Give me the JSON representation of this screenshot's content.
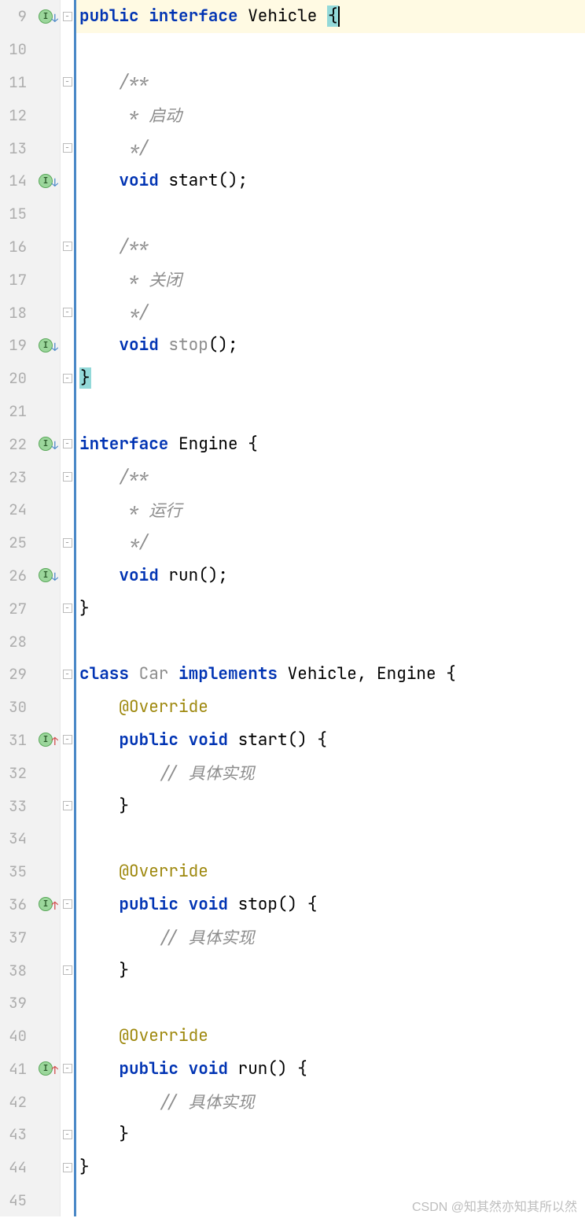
{
  "watermark": "CSDN @知其然亦知其所以然",
  "lines": [
    {
      "n": "9",
      "badge": "I",
      "arrow": "down",
      "foldOpen": true,
      "hl": true,
      "tokens": [
        [
          "kw",
          "public "
        ],
        [
          "kw",
          "interface "
        ],
        [
          "type",
          "Vehicle "
        ],
        [
          "hl-brace",
          "{"
        ],
        [
          "cursor",
          ""
        ]
      ]
    },
    {
      "n": "10",
      "tokens": []
    },
    {
      "n": "11",
      "foldOpen": true,
      "tokens": [
        [
          "plain",
          "    "
        ],
        [
          "comment",
          "/**"
        ]
      ]
    },
    {
      "n": "12",
      "tokens": [
        [
          "plain",
          "     "
        ],
        [
          "comment",
          "* 启动"
        ]
      ]
    },
    {
      "n": "13",
      "foldClose": true,
      "tokens": [
        [
          "plain",
          "     "
        ],
        [
          "comment",
          "*/"
        ]
      ]
    },
    {
      "n": "14",
      "badge": "I",
      "arrow": "down",
      "tokens": [
        [
          "plain",
          "    "
        ],
        [
          "kw",
          "void "
        ],
        [
          "ident",
          "start"
        ],
        [
          "paren",
          "();"
        ]
      ]
    },
    {
      "n": "15",
      "tokens": []
    },
    {
      "n": "16",
      "foldOpen": true,
      "tokens": [
        [
          "plain",
          "    "
        ],
        [
          "comment",
          "/**"
        ]
      ]
    },
    {
      "n": "17",
      "tokens": [
        [
          "plain",
          "     "
        ],
        [
          "comment",
          "* 关闭"
        ]
      ]
    },
    {
      "n": "18",
      "foldClose": true,
      "tokens": [
        [
          "plain",
          "     "
        ],
        [
          "comment",
          "*/"
        ]
      ]
    },
    {
      "n": "19",
      "badge": "I",
      "arrow": "down",
      "tokens": [
        [
          "plain",
          "    "
        ],
        [
          "kw",
          "void "
        ],
        [
          "dim",
          "stop"
        ],
        [
          "paren",
          "();"
        ]
      ]
    },
    {
      "n": "20",
      "foldClose": true,
      "tokens": [
        [
          "hl-brace",
          "}"
        ]
      ]
    },
    {
      "n": "21",
      "tokens": []
    },
    {
      "n": "22",
      "badge": "I",
      "arrow": "down",
      "foldOpen": true,
      "tokens": [
        [
          "kw",
          "interface "
        ],
        [
          "type",
          "Engine "
        ],
        [
          "paren",
          "{"
        ]
      ]
    },
    {
      "n": "23",
      "foldOpen": true,
      "tokens": [
        [
          "plain",
          "    "
        ],
        [
          "comment",
          "/**"
        ]
      ]
    },
    {
      "n": "24",
      "tokens": [
        [
          "plain",
          "     "
        ],
        [
          "comment",
          "* 运行"
        ]
      ]
    },
    {
      "n": "25",
      "foldClose": true,
      "tokens": [
        [
          "plain",
          "     "
        ],
        [
          "comment",
          "*/"
        ]
      ]
    },
    {
      "n": "26",
      "badge": "I",
      "arrow": "down",
      "tokens": [
        [
          "plain",
          "    "
        ],
        [
          "kw",
          "void "
        ],
        [
          "ident",
          "run"
        ],
        [
          "paren",
          "();"
        ]
      ]
    },
    {
      "n": "27",
      "foldClose": true,
      "tokens": [
        [
          "paren",
          "}"
        ]
      ]
    },
    {
      "n": "28",
      "tokens": []
    },
    {
      "n": "29",
      "foldOpen": true,
      "tokens": [
        [
          "kw",
          "class "
        ],
        [
          "dim",
          "Car "
        ],
        [
          "kw",
          "implements "
        ],
        [
          "type",
          "Vehicle"
        ],
        [
          "paren",
          ", "
        ],
        [
          "type",
          "Engine "
        ],
        [
          "paren",
          "{"
        ]
      ]
    },
    {
      "n": "30",
      "tokens": [
        [
          "plain",
          "    "
        ],
        [
          "annot",
          "@Override"
        ]
      ]
    },
    {
      "n": "31",
      "badge": "I",
      "arrow": "up",
      "foldOpen": true,
      "tokens": [
        [
          "plain",
          "    "
        ],
        [
          "kw",
          "public "
        ],
        [
          "kw",
          "void "
        ],
        [
          "ident",
          "start"
        ],
        [
          "paren",
          "() {"
        ]
      ]
    },
    {
      "n": "32",
      "tokens": [
        [
          "plain",
          "        "
        ],
        [
          "comment",
          "// 具体实现"
        ]
      ]
    },
    {
      "n": "33",
      "foldClose": true,
      "tokens": [
        [
          "plain",
          "    "
        ],
        [
          "paren",
          "}"
        ]
      ]
    },
    {
      "n": "34",
      "tokens": []
    },
    {
      "n": "35",
      "tokens": [
        [
          "plain",
          "    "
        ],
        [
          "annot",
          "@Override"
        ]
      ]
    },
    {
      "n": "36",
      "badge": "I",
      "arrow": "up",
      "foldOpen": true,
      "tokens": [
        [
          "plain",
          "    "
        ],
        [
          "kw",
          "public "
        ],
        [
          "kw",
          "void "
        ],
        [
          "ident",
          "stop"
        ],
        [
          "paren",
          "() {"
        ]
      ]
    },
    {
      "n": "37",
      "tokens": [
        [
          "plain",
          "        "
        ],
        [
          "comment",
          "// 具体实现"
        ]
      ]
    },
    {
      "n": "38",
      "foldClose": true,
      "tokens": [
        [
          "plain",
          "    "
        ],
        [
          "paren",
          "}"
        ]
      ]
    },
    {
      "n": "39",
      "tokens": []
    },
    {
      "n": "40",
      "tokens": [
        [
          "plain",
          "    "
        ],
        [
          "annot",
          "@Override"
        ]
      ]
    },
    {
      "n": "41",
      "badge": "I",
      "arrow": "up",
      "foldOpen": true,
      "tokens": [
        [
          "plain",
          "    "
        ],
        [
          "kw",
          "public "
        ],
        [
          "kw",
          "void "
        ],
        [
          "ident",
          "run"
        ],
        [
          "paren",
          "() {"
        ]
      ]
    },
    {
      "n": "42",
      "tokens": [
        [
          "plain",
          "        "
        ],
        [
          "comment",
          "// 具体实现"
        ]
      ]
    },
    {
      "n": "43",
      "foldClose": true,
      "tokens": [
        [
          "plain",
          "    "
        ],
        [
          "paren",
          "}"
        ]
      ]
    },
    {
      "n": "44",
      "foldClose": true,
      "tokens": [
        [
          "paren",
          "}"
        ]
      ]
    },
    {
      "n": "45",
      "tokens": []
    }
  ]
}
